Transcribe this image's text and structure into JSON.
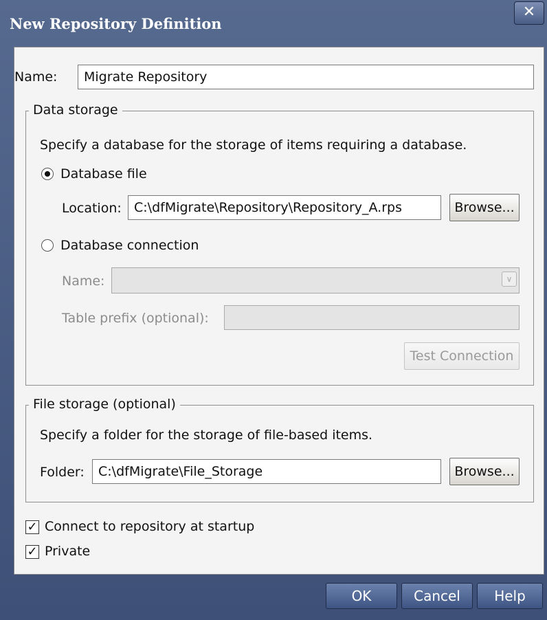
{
  "window": {
    "title": "New Repository Definition",
    "close_label": "✕"
  },
  "name": {
    "label": "Name:",
    "value": "Migrate Repository"
  },
  "data_storage": {
    "legend": "Data storage",
    "description": "Specify a database for the storage of items requiring a database.",
    "database_file": {
      "label": "Database file",
      "selected": true,
      "location_label": "Location:",
      "location_value": "C:\\dfMigrate\\Repository\\Repository_A.rps",
      "browse_label": "Browse..."
    },
    "database_connection": {
      "label": "Database connection",
      "selected": false,
      "name_label": "Name:",
      "name_value": "",
      "table_prefix_label": "Table prefix (optional):",
      "table_prefix_value": "",
      "test_connection_label": "Test Connection"
    }
  },
  "file_storage": {
    "legend": "File storage (optional)",
    "description": "Specify a folder for the storage of file-based items.",
    "folder_label": "Folder:",
    "folder_value": "C:\\dfMigrate\\File_Storage",
    "browse_label": "Browse..."
  },
  "options": {
    "connect_at_startup": {
      "label": "Connect to repository at startup",
      "checked": true
    },
    "private": {
      "label": "Private",
      "checked": true
    }
  },
  "footer": {
    "ok_label": "OK",
    "cancel_label": "Cancel",
    "help_label": "Help"
  },
  "colors": {
    "title_bar": "#4a5d85",
    "panel": "#f4f4f4",
    "button_blue": "#4f6694"
  }
}
